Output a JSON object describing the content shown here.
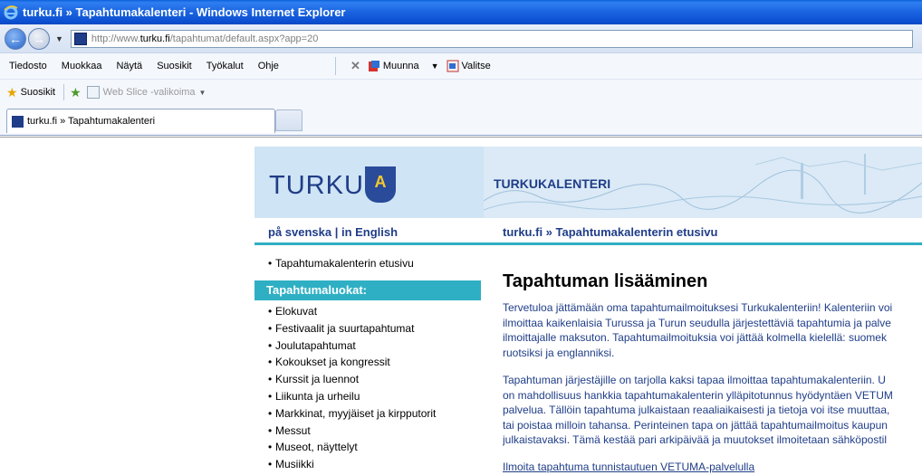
{
  "window": {
    "title": "turku.fi » Tapahtumakalenteri - Windows Internet Explorer"
  },
  "address": {
    "url_prefix": "http://www.",
    "url_domain": "turku.fi",
    "url_path": "/tapahtumat/default.aspx?app=20"
  },
  "menu": {
    "items": [
      "Tiedosto",
      "Muokkaa",
      "Näytä",
      "Suosikit",
      "Työkalut",
      "Ohje"
    ],
    "tool_muunna": "Muunna",
    "tool_valitse": "Valitse"
  },
  "favorites": {
    "suosikit": "Suosikit",
    "web_slice": "Web Slice -valikoima"
  },
  "tab": {
    "title": "turku.fi » Tapahtumakalenteri"
  },
  "site": {
    "logo_text": "TURKU",
    "calendar_label": "TURKUKALENTERI",
    "lang_links": "på svenska | in English",
    "breadcrumb": "turku.fi » Tapahtumakalenterin etusivu",
    "home_link": "Tapahtumakalenterin etusivu",
    "categories_header": "Tapahtumaluokat:",
    "categories": [
      "Elokuvat",
      "Festivaalit ja suurtapahtumat",
      "Joulutapahtumat",
      "Kokoukset ja kongressit",
      "Kurssit ja luennot",
      "Liikunta ja urheilu",
      "Markkinat, myyjäiset ja kirpputorit",
      "Messut",
      "Museot, näyttelyt",
      "Musiikki"
    ]
  },
  "main": {
    "heading": "Tapahtuman lisääminen",
    "para1": [
      "Tervetuloa jättämään oma tapahtumailmoituksesi Turkukalenteriin! Kalenteriin voi",
      "ilmoittaa kaikenlaisia Turussa ja Turun seudulla järjestettäviä tapahtumia ja palve",
      "ilmoittajalle maksuton. Tapahtumailmoituksia voi jättää kolmella kielellä: suomek",
      "ruotsiksi ja englanniksi."
    ],
    "para2": [
      "Tapahtuman järjestäjille on tarjolla kaksi tapaa ilmoittaa tapahtumakalenteriin. U",
      "on mahdollisuus hankkia tapahtumakalenterin ylläpitotunnus hyödyntäen VETUM",
      "palvelua. Tällöin tapahtuma julkaistaan reaaliaikaisesti ja tietoja voi itse muuttaa,",
      "tai poistaa milloin tahansa. Perinteinen tapa on jättää tapahtumailmoitus kaupun",
      "julkaistavaksi. Tämä kestää pari arkipäivää ja muutokset ilmoitetaan sähköpostil"
    ],
    "vetuma_link": "Ilmoita tapahtuma tunnistautuen VETUMA-palvelulla"
  }
}
